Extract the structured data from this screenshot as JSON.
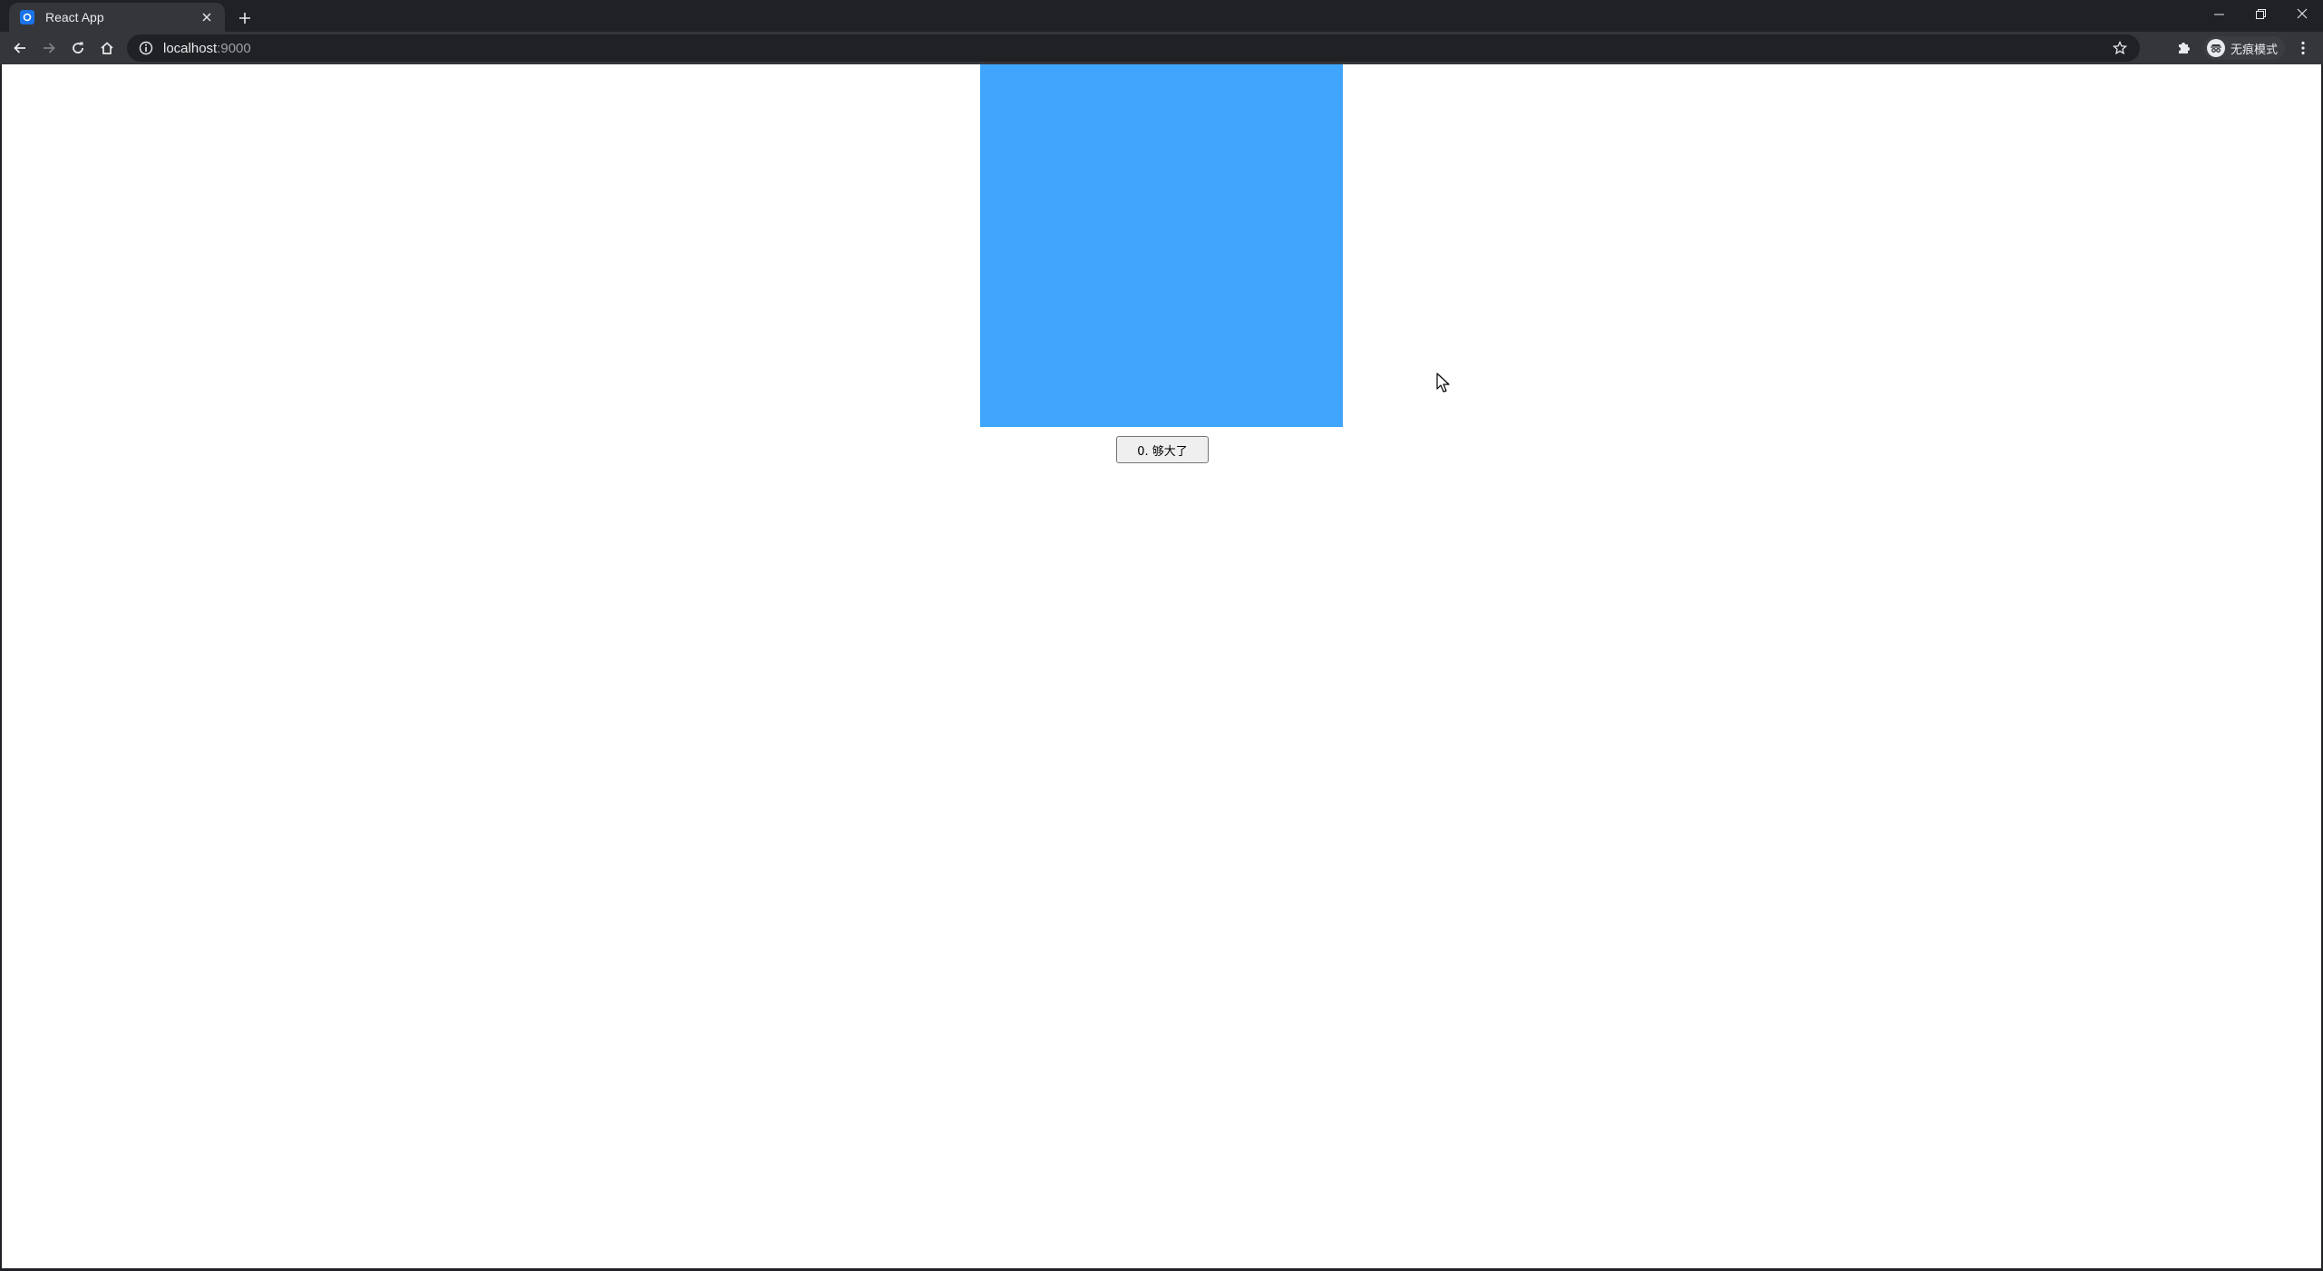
{
  "browser": {
    "tab": {
      "title": "React App",
      "favicon": "react-favicon-icon"
    },
    "omnibox": {
      "host": "localhost",
      "port": ":9000",
      "info_icon": "info-icon"
    },
    "incognito": {
      "label": "无痕模式"
    },
    "colors": {
      "chrome_dark": "#202124",
      "toolbar": "#35363a",
      "accent_blue": "#1a73e8"
    }
  },
  "page": {
    "box": {
      "color": "#40a6fd"
    },
    "button": {
      "label": "0. 够大了"
    }
  }
}
